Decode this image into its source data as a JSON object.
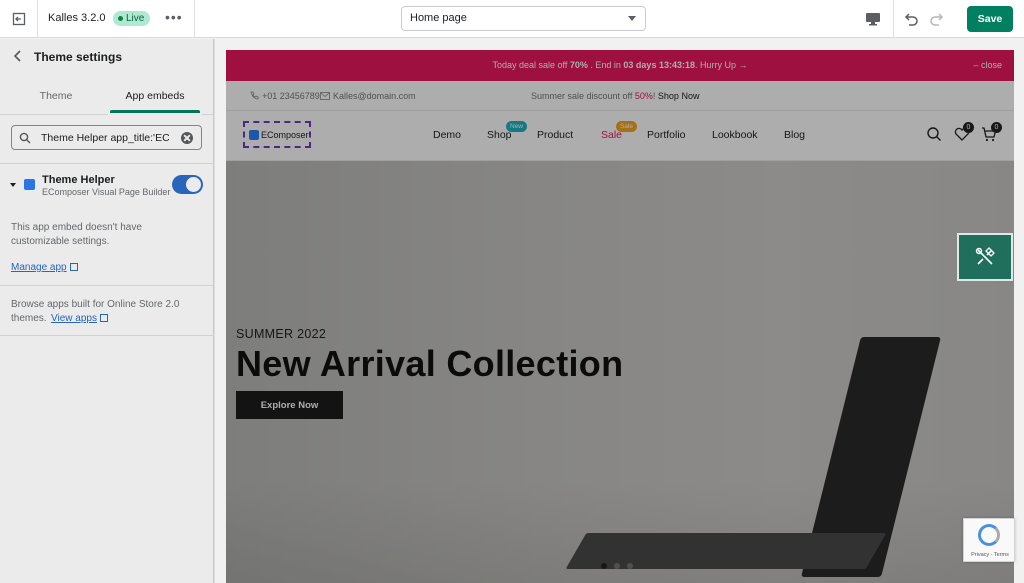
{
  "topbar": {
    "theme_name": "Kalles 3.2.0",
    "status": "Live",
    "more": "•••",
    "page_select": "Home page",
    "save_label": "Save"
  },
  "sidebar": {
    "title": "Theme settings",
    "tabs": [
      {
        "label": "Theme",
        "active": false
      },
      {
        "label": "App embeds",
        "active": true
      }
    ],
    "search_value": "Theme Helper app_title:'EC",
    "embed": {
      "name": "Theme Helper",
      "subtitle": "EComposer Visual Page Builder",
      "enabled": true
    },
    "no_settings_text": "This app embed doesn't have customizable settings.",
    "manage_link": "Manage app",
    "browse_text": "Browse apps built for Online Store 2.0 themes.",
    "view_apps_link": "View apps"
  },
  "preview": {
    "announcement": {
      "prefix": "Today deal sale off ",
      "percent": "70%",
      "mid": " . End in ",
      "countdown": "03 days 13:43:18",
      "suffix": ". Hurry Up →",
      "close": "– close"
    },
    "info": {
      "phone": "+01 23456789",
      "email": "Kalles@domain.com",
      "sale_prefix": "Summer sale discount off ",
      "sale_pct": "50%",
      "sale_suffix": "! ",
      "shop_now": "Shop Now"
    },
    "logo_text": "EComposer",
    "nav": [
      {
        "label": "Demo"
      },
      {
        "label": "Shop",
        "badge": "New"
      },
      {
        "label": "Product"
      },
      {
        "label": "Sale",
        "badge": "Sale"
      },
      {
        "label": "Portfolio"
      },
      {
        "label": "Lookbook"
      },
      {
        "label": "Blog"
      }
    ],
    "wishlist_count": "0",
    "cart_count": "0",
    "hero": {
      "kicker": "SUMMER 2022",
      "headline": "New Arrival Collection",
      "cta": "Explore Now",
      "slides": 3,
      "active_slide": 1
    },
    "recaptcha_text": "Privacy - Terms"
  },
  "colors": {
    "primary_green": "#008060",
    "announcement_pink": "#e8185f",
    "toggle_blue": "#2c6ecb",
    "live_badge": "#aee9d1",
    "ecomposer_float": "#1f6f5c"
  },
  "icons": [
    "exit-icon",
    "more-icon",
    "desktop-icon",
    "undo-icon",
    "redo-icon",
    "back-arrow-icon",
    "search-icon",
    "clear-icon",
    "chevron-down-icon",
    "app-icon",
    "external-link-icon",
    "phone-icon",
    "mail-icon",
    "search-icon",
    "heart-icon",
    "cart-icon",
    "tools-icon",
    "recaptcha-icon"
  ]
}
